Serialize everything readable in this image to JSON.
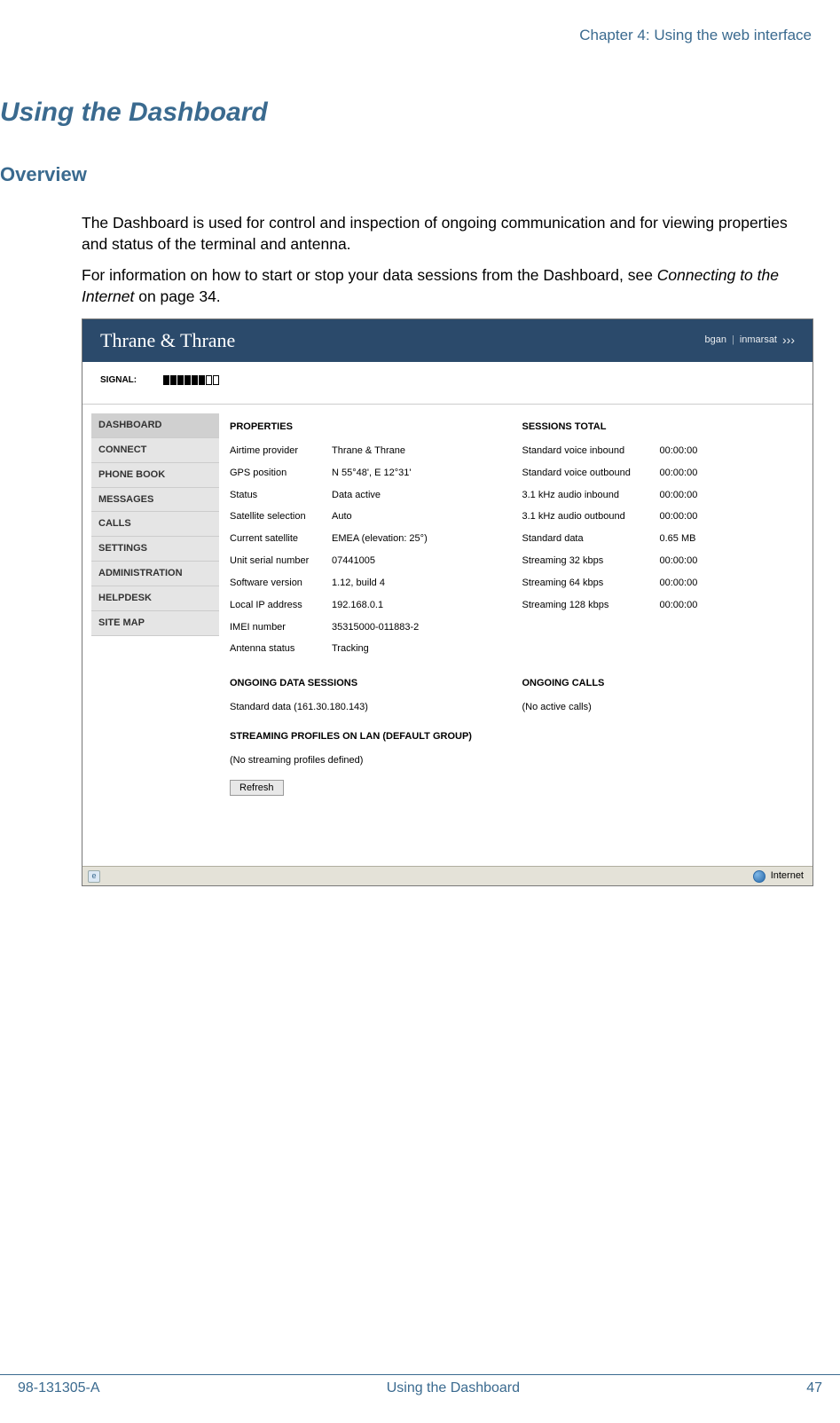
{
  "header": {
    "chapter": "Chapter 4: Using the web interface"
  },
  "h1": "Using the Dashboard",
  "h2": "Overview",
  "para1": "The Dashboard is used for control and inspection of ongoing communication and for viewing properties and status of the terminal and antenna.",
  "para2_a": "For information on how to start or stop your data sessions from the Dashboard, see ",
  "para2_ital": "Connecting to the Internet",
  "para2_b": " on page 34.",
  "shot": {
    "brand_left": "Thrane & Thrane",
    "brand_right_a": "bgan",
    "brand_right_b": "inmarsat",
    "signal_label": "SIGNAL:",
    "signal_filled": 6,
    "signal_total": 8,
    "nav": [
      "DASHBOARD",
      "CONNECT",
      "PHONE BOOK",
      "MESSAGES",
      "CALLS",
      "SETTINGS",
      "ADMINISTRATION",
      "HELPDESK",
      "SITE MAP"
    ],
    "nav_active_index": 0,
    "properties_title": "PROPERTIES",
    "properties": [
      {
        "k": "Airtime provider",
        "v": "Thrane & Thrane"
      },
      {
        "k": "GPS position",
        "v": "N 55°48', E 12°31'"
      },
      {
        "k": "Status",
        "v": "Data active"
      },
      {
        "k": "Satellite selection",
        "v": "Auto"
      },
      {
        "k": "Current satellite",
        "v": "EMEA (elevation: 25°)"
      },
      {
        "k": "Unit serial number",
        "v": "07441005"
      },
      {
        "k": "Software version",
        "v": "1.12, build 4"
      },
      {
        "k": "Local IP address",
        "v": "192.168.0.1"
      },
      {
        "k": "IMEI number",
        "v": "35315000-011883-2"
      },
      {
        "k": "Antenna status",
        "v": "Tracking"
      }
    ],
    "sessions_title": "SESSIONS TOTAL",
    "sessions": [
      {
        "k": "Standard voice inbound",
        "v": "00:00:00"
      },
      {
        "k": "Standard voice outbound",
        "v": "00:00:00"
      },
      {
        "k": "3.1 kHz audio inbound",
        "v": "00:00:00"
      },
      {
        "k": "3.1 kHz audio outbound",
        "v": "00:00:00"
      },
      {
        "k": "Standard data",
        "v": "0.65 MB"
      },
      {
        "k": "Streaming 32 kbps",
        "v": "00:00:00"
      },
      {
        "k": "Streaming 64 kbps",
        "v": "00:00:00"
      },
      {
        "k": "Streaming 128 kbps",
        "v": "00:00:00"
      }
    ],
    "ongoing_data_title": "ONGOING DATA SESSIONS",
    "ongoing_data_value": "Standard data (161.30.180.143)",
    "ongoing_calls_title": "ONGOING CALLS",
    "ongoing_calls_value": "(No active calls)",
    "profiles_title": "STREAMING PROFILES ON LAN (DEFAULT GROUP)",
    "profiles_none": "(No streaming profiles defined)",
    "refresh_label": "Refresh",
    "statusbar_zone": "Internet"
  },
  "footer": {
    "left": "98-131305-A",
    "center": "Using the Dashboard",
    "right": "47"
  }
}
